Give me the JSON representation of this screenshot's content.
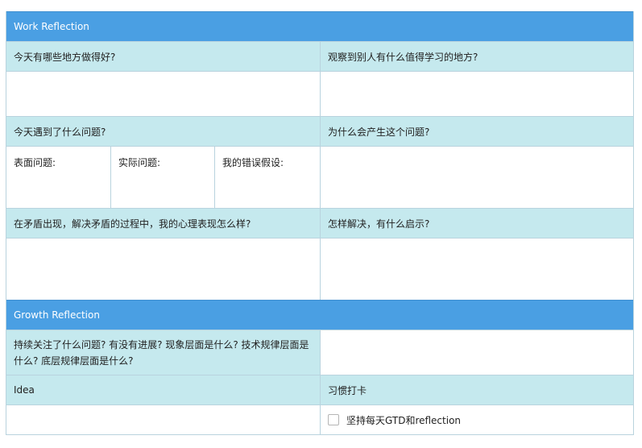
{
  "work": {
    "title": "Work Reflection",
    "q_good": "今天有哪些地方做得好?",
    "q_learn": "观察到别人有什么值得学习的地方?",
    "q_problem": "今天遇到了什么问题?",
    "q_why": "为什么会产生这个问题?",
    "surface": "表面问题:",
    "actual": "实际问题:",
    "assumption": "我的错误假设:",
    "q_mind": "在矛盾出现，解决矛盾的过程中，我的心理表现怎么样?",
    "q_solve": "怎样解决，有什么启示?"
  },
  "growth": {
    "title": "Growth Reflection",
    "q_follow": "持续关注了什么问题? 有没有进展? 现象层面是什么? 技术规律层面是什么? 底层规律层面是什么?",
    "idea": "Idea",
    "habit": "习惯打卡",
    "habit_item": "坚持每天GTD和reflection"
  }
}
